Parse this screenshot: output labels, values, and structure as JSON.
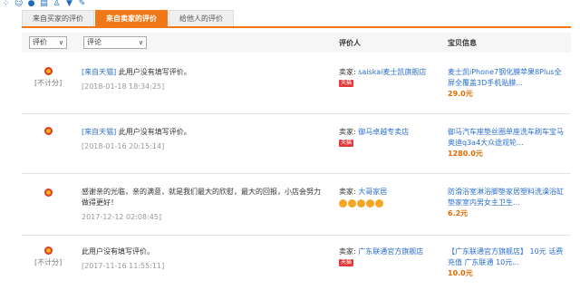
{
  "toolbar": {
    "icons": [
      "grid-icon",
      "smile-icon",
      "mic-icon",
      "keyboard-icon",
      "person-icon",
      "shirt-icon",
      "wrench-icon"
    ]
  },
  "tabs": [
    {
      "label": "来自买家的评价"
    },
    {
      "label": "来自卖家的评价"
    },
    {
      "label": "给他人的评价"
    }
  ],
  "header": {
    "rating_select": "评价",
    "comment_select": "评论",
    "reviewer_label": "评价人",
    "item_label": "宝贝信息"
  },
  "rows": [
    {
      "no_count": "[不计分]",
      "source": "[来自天猫]",
      "text": "此用户没有填写评价。",
      "date": "[2018-01-18 18:34:25]",
      "seller_label": "卖家:",
      "seller_name": "saiskai麦士凯旗舰店",
      "badge": "天猫",
      "item_name": "麦士凯iPhone7钢化膜苹果8Plus全屏全覆盖3D手机贴膜...",
      "price": "29.0",
      "unit": "元"
    },
    {
      "no_count": "",
      "source": "[来自天猫]",
      "text": "此用户没有填写评价。",
      "date": "[2018-01-16 20:15:14]",
      "seller_label": "卖家:",
      "seller_name": "御马卓越专卖店",
      "badge": "天猫",
      "item_name": "御马汽车座垫丝圈单座洗车刷车宝马奥迪q3a4大众途观轮...",
      "price": "1280.0",
      "unit": "元"
    },
    {
      "no_count": "",
      "source": "",
      "text": "感谢亲的光临，亲的满意，就是我们最大的欣慰，最大的回报，小店会努力做得更好！",
      "date": "2017-12-12 02:08:45]",
      "seller_label": "卖家:",
      "seller_name": "大哥家居",
      "badge": "",
      "item_name": "防滑浴室淋浴脚垫家居塑料洗澡浴缸垫家室内男女主卫生...",
      "price": "6.2",
      "unit": "元"
    },
    {
      "no_count": "[不计分]",
      "source": "",
      "text": "此用户没有填写评价。",
      "date": "[2017-11-16 11:55:11]",
      "seller_label": "卖家:",
      "seller_name": "广东联通官方旗舰店",
      "badge": "天猫",
      "item_name": "【广东联通官方旗舰店】 10元 话费充值 广东联通 10元...",
      "price": "10.0",
      "unit": "元"
    }
  ]
}
